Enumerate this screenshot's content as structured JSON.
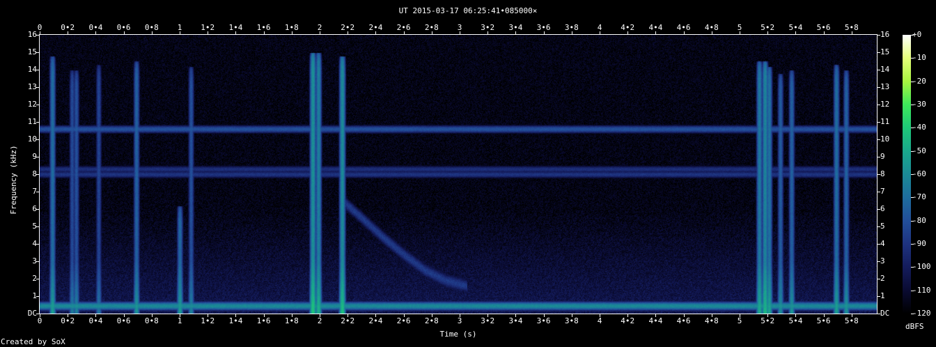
{
  "header": {
    "title": "UT 2015-03-17 06:25:41•085000×"
  },
  "footer": {
    "credit": "Created by SoX"
  },
  "chart_data": {
    "type": "heatmap",
    "title": "UT 2015-03-17 06:25:41•085000×",
    "xlabel": "Time (s)",
    "ylabel": "Frequency (kHz)",
    "colorbar_label": "dBFS",
    "xlim": [
      0,
      5.98
    ],
    "ylim": [
      0,
      16
    ],
    "zlim": [
      -120,
      0
    ],
    "x_ticks": [
      0,
      0.2,
      0.4,
      0.6,
      0.8,
      1,
      1.2,
      1.4,
      1.6,
      1.8,
      2,
      2.2,
      2.4,
      2.6,
      2.8,
      3,
      3.2,
      3.4,
      3.6,
      3.8,
      4,
      4.2,
      4.4,
      4.6,
      4.8,
      5,
      5.2,
      5.4,
      5.6,
      5.8
    ],
    "x_tick_labels": [
      "0",
      "0•2",
      "0•4",
      "0•6",
      "0•8",
      "1",
      "1•2",
      "1•4",
      "1•6",
      "1•8",
      "2",
      "2•2",
      "2•4",
      "2•6",
      "2•8",
      "3",
      "3•2",
      "3•4",
      "3•6",
      "3•8",
      "4",
      "4•2",
      "4•4",
      "4•6",
      "4•8",
      "5",
      "5•2",
      "5•4",
      "5•6",
      "5•8"
    ],
    "y_ticks": [
      0,
      1,
      2,
      3,
      4,
      5,
      6,
      7,
      8,
      9,
      10,
      11,
      12,
      13,
      14,
      15,
      16
    ],
    "y_tick_labels": [
      "DC",
      "1",
      "2",
      "3",
      "4",
      "5",
      "6",
      "7",
      "8",
      "9",
      "10",
      "11",
      "12",
      "13",
      "14",
      "15",
      "16"
    ],
    "colorbar_ticks": [
      0,
      -10,
      -20,
      -30,
      -40,
      -50,
      -60,
      -70,
      -80,
      -90,
      -100,
      -110,
      -120
    ],
    "colorbar_tick_labels": [
      "+0",
      "-10",
      "-20",
      "-30",
      "-40",
      "-50",
      "-60",
      "-70",
      "-80",
      "-90",
      "-100",
      "-110",
      "-120"
    ],
    "colormap": [
      "#ffffff",
      "#e6ff7a",
      "#a8f540",
      "#3ee85a",
      "#1ec878",
      "#1aa88c",
      "#1b8a96",
      "#1e6d9e",
      "#224f9a",
      "#1e3380",
      "#141c5c",
      "#0a0b32",
      "#000000"
    ],
    "background_level_dbfs": -100,
    "tones": [
      {
        "freq_khz": 10.6,
        "level_dbfs": -80
      },
      {
        "freq_khz": 8.3,
        "level_dbfs": -92
      },
      {
        "freq_khz": 8.0,
        "level_dbfs": -90
      },
      {
        "freq_khz": 0.45,
        "level_dbfs": -60
      }
    ],
    "impulses": [
      {
        "t": 0.09,
        "f_top": 14.8,
        "level_dbfs": -70
      },
      {
        "t": 0.23,
        "f_top": 14,
        "level_dbfs": -82
      },
      {
        "t": 0.26,
        "f_top": 14,
        "level_dbfs": -80
      },
      {
        "t": 0.42,
        "f_top": 14.3,
        "level_dbfs": -84
      },
      {
        "t": 0.69,
        "f_top": 14.5,
        "level_dbfs": -74
      },
      {
        "t": 1.0,
        "f_top": 6.2,
        "level_dbfs": -72
      },
      {
        "t": 1.08,
        "f_top": 14.2,
        "level_dbfs": -80
      },
      {
        "t": 1.95,
        "f_top": 15,
        "level_dbfs": -58
      },
      {
        "t": 1.99,
        "f_top": 15,
        "level_dbfs": -64
      },
      {
        "t": 2.16,
        "f_top": 14.8,
        "level_dbfs": -60
      },
      {
        "t": 5.14,
        "f_top": 14.5,
        "level_dbfs": -66
      },
      {
        "t": 5.18,
        "f_top": 14.5,
        "level_dbfs": -62
      },
      {
        "t": 5.21,
        "f_top": 14.2,
        "level_dbfs": -68
      },
      {
        "t": 5.29,
        "f_top": 13.8,
        "level_dbfs": -76
      },
      {
        "t": 5.37,
        "f_top": 14,
        "level_dbfs": -74
      },
      {
        "t": 5.69,
        "f_top": 14.3,
        "level_dbfs": -70
      },
      {
        "t": 5.76,
        "f_top": 14,
        "level_dbfs": -74
      }
    ],
    "whistler": {
      "level_dbfs": -88,
      "points": [
        {
          "t": 2.16,
          "f_khz": 6.5
        },
        {
          "t": 2.3,
          "f_khz": 5.5
        },
        {
          "t": 2.45,
          "f_khz": 4.4
        },
        {
          "t": 2.6,
          "f_khz": 3.4
        },
        {
          "t": 2.75,
          "f_khz": 2.5
        },
        {
          "t": 2.9,
          "f_khz": 1.9
        },
        {
          "t": 3.05,
          "f_khz": 1.6
        }
      ]
    }
  }
}
